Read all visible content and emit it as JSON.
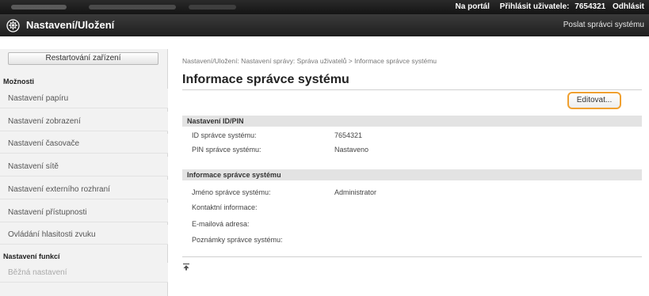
{
  "topbar": {
    "portal_link": "Na portál",
    "login_label": "Přihlásit uživatele:",
    "user_id": "7654321",
    "logout_link": "Odhlásit"
  },
  "header": {
    "app_title": "Nastavení/Uložení",
    "send_link": "Poslat správci systému",
    "icon": "settings-icon"
  },
  "sidebar": {
    "restart_label": "Restartování zařízení",
    "section_options": "Možnosti",
    "items": [
      {
        "label": "Nastavení papíru"
      },
      {
        "label": "Nastavení zobrazení"
      },
      {
        "label": "Nastavení časovače"
      },
      {
        "label": "Nastavení sítě"
      },
      {
        "label": "Nastavení externího rozhraní"
      },
      {
        "label": "Nastavení přístupnosti"
      },
      {
        "label": "Ovládání hlasitosti zvuku"
      }
    ],
    "section_functions": "Nastavení funkcí",
    "function_items": [
      {
        "label": "Běžná nastavení"
      }
    ]
  },
  "main": {
    "breadcrumb": "Nastavení/Uložení: Nastavení správy: Správa uživatelů > Informace správce systému",
    "page_title": "Informace správce systému",
    "edit_label": "Editovat...",
    "sections": [
      {
        "title": "Nastavení ID/PIN",
        "rows": [
          {
            "label": "ID správce systému:",
            "value": "7654321"
          },
          {
            "label": "PIN správce systému:",
            "value": "Nastaveno"
          }
        ]
      },
      {
        "title": "Informace správce systému",
        "rows": [
          {
            "label": "Jméno správce systému:",
            "value": "Administrator"
          },
          {
            "label": "Kontaktní informace:",
            "value": ""
          },
          {
            "label": "E-mailová adresa:",
            "value": ""
          },
          {
            "label": "Poznámky správce systému:",
            "value": ""
          }
        ]
      }
    ],
    "top_icon": "back-to-top-icon"
  },
  "colors": {
    "header_bg": "#1f1f1f",
    "highlight": "#f0a030",
    "section_bg": "#e3e3e3"
  }
}
